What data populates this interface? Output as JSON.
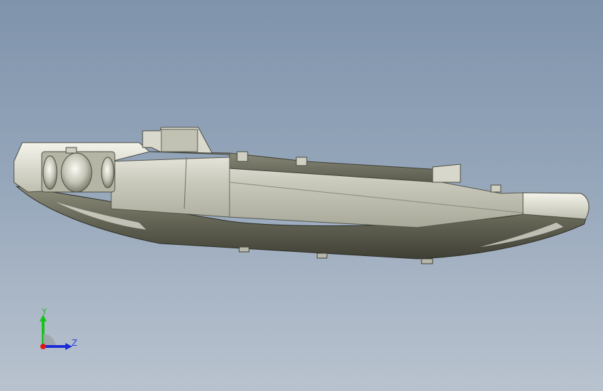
{
  "triad": {
    "y_label": "Y",
    "z_label": "Z",
    "colors": {
      "y_axis": "#18c21e",
      "z_axis": "#1c2ad8",
      "x_axis": "#e01818",
      "y_label": "#27b82b",
      "z_label": "#2a3fd6"
    }
  }
}
